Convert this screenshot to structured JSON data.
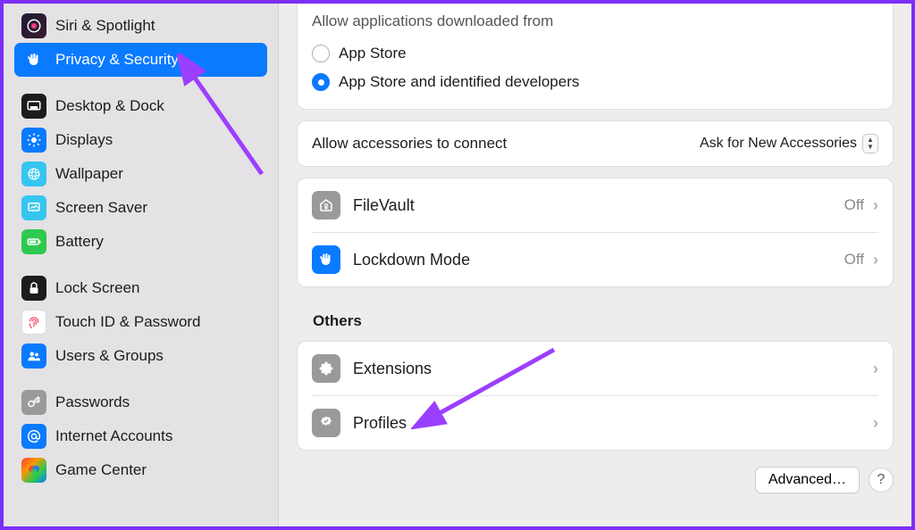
{
  "sidebar": {
    "groups": [
      {
        "items": [
          {
            "label": "Siri & Spotlight",
            "icon": "siri",
            "bg": "linear-gradient(135deg,#1b1b3a,#3a1b2a)",
            "color": "#fff"
          },
          {
            "label": "Privacy & Security",
            "icon": "hand",
            "bg": "#0a7aff",
            "color": "#fff",
            "selected": true
          }
        ]
      },
      {
        "items": [
          {
            "label": "Desktop & Dock",
            "icon": "dock",
            "bg": "#1c1c1c",
            "color": "#fff"
          },
          {
            "label": "Displays",
            "icon": "displays",
            "bg": "#0a7aff",
            "color": "#fff"
          },
          {
            "label": "Wallpaper",
            "icon": "wallpaper",
            "bg": "#35c6f0",
            "color": "#fff"
          },
          {
            "label": "Screen Saver",
            "icon": "screensaver",
            "bg": "#35c6f0",
            "color": "#fff"
          },
          {
            "label": "Battery",
            "icon": "battery",
            "bg": "#2ec94e",
            "color": "#fff"
          }
        ]
      },
      {
        "items": [
          {
            "label": "Lock Screen",
            "icon": "lock",
            "bg": "#1c1c1c",
            "color": "#fff"
          },
          {
            "label": "Touch ID & Password",
            "icon": "fingerprint",
            "bg": "#ffffff",
            "color": "#ff2d55"
          },
          {
            "label": "Users & Groups",
            "icon": "users",
            "bg": "#0a7aff",
            "color": "#fff"
          }
        ]
      },
      {
        "items": [
          {
            "label": "Passwords",
            "icon": "key",
            "bg": "#9a9a9a",
            "color": "#fff"
          },
          {
            "label": "Internet Accounts",
            "icon": "at",
            "bg": "#0a7aff",
            "color": "#fff"
          },
          {
            "label": "Game Center",
            "icon": "gamecenter",
            "bg": "linear-gradient(135deg,#ff3b3b,#ff9500,#2ec94e,#0a7aff)",
            "color": "#fff"
          }
        ]
      }
    ]
  },
  "main": {
    "download": {
      "heading": "Allow applications downloaded from",
      "options": [
        {
          "label": "App Store",
          "checked": false
        },
        {
          "label": "App Store and identified developers",
          "checked": true
        }
      ]
    },
    "accessories": {
      "label": "Allow accessories to connect",
      "value": "Ask for New Accessories"
    },
    "privacyRows": [
      {
        "label": "FileVault",
        "value": "Off",
        "iconBg": "#9a9a9a",
        "icon": "filevault"
      },
      {
        "label": "Lockdown Mode",
        "value": "Off",
        "iconBg": "#0a7aff",
        "icon": "hand"
      }
    ],
    "othersTitle": "Others",
    "otherRows": [
      {
        "label": "Extensions",
        "iconBg": "#9a9a9a",
        "icon": "puzzle"
      },
      {
        "label": "Profiles",
        "iconBg": "#9a9a9a",
        "icon": "badge"
      }
    ],
    "advanced": "Advanced…",
    "help": "?"
  }
}
